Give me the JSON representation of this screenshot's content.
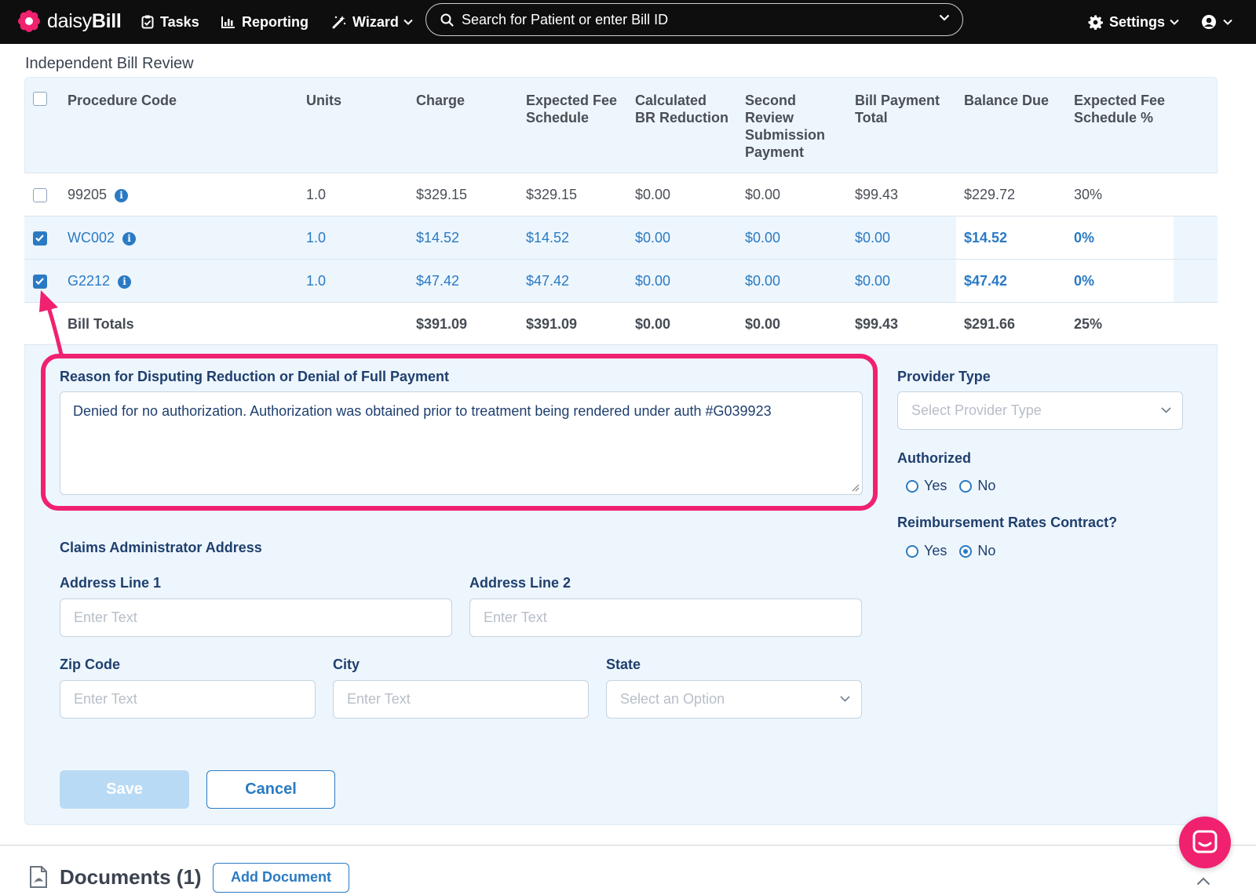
{
  "nav": {
    "logo_prefix": "daisy",
    "logo_suffix": "Bill",
    "tasks": "Tasks",
    "reporting": "Reporting",
    "wizard": "Wizard",
    "search_placeholder": "Search for Patient or enter Bill ID",
    "settings": "Settings"
  },
  "section_title": "Independent Bill Review",
  "table": {
    "headers": [
      [
        "Procedure Code"
      ],
      [
        "Units"
      ],
      [
        "Charge"
      ],
      [
        "Expected Fee",
        "Schedule"
      ],
      [
        "Calculated",
        "BR Reduction"
      ],
      [
        "Second",
        "Review",
        "Submission",
        "Payment"
      ],
      [
        "Bill Payment",
        "Total"
      ],
      [
        "Balance Due"
      ],
      [
        "Expected Fee",
        "Schedule %"
      ]
    ],
    "rows": [
      {
        "selected": false,
        "code": "99205",
        "units": "1.0",
        "charge": "$329.15",
        "expected_fee": "$329.15",
        "br_reduction": "$0.00",
        "second_review": "$0.00",
        "bill_payment": "$99.43",
        "balance_due": "$229.72",
        "fee_pct": "30%"
      },
      {
        "selected": true,
        "code": "WC002",
        "units": "1.0",
        "charge": "$14.52",
        "expected_fee": "$14.52",
        "br_reduction": "$0.00",
        "second_review": "$0.00",
        "bill_payment": "$0.00",
        "balance_due": "$14.52",
        "fee_pct": "0%"
      },
      {
        "selected": true,
        "code": "G2212",
        "units": "1.0",
        "charge": "$47.42",
        "expected_fee": "$47.42",
        "br_reduction": "$0.00",
        "second_review": "$0.00",
        "bill_payment": "$0.00",
        "balance_due": "$47.42",
        "fee_pct": "0%"
      }
    ],
    "totals": {
      "label": "Bill Totals",
      "charge": "$391.09",
      "expected_fee": "$391.09",
      "br_reduction": "$0.00",
      "second_review": "$0.00",
      "bill_payment": "$99.43",
      "balance_due": "$291.66",
      "fee_pct": "25%"
    }
  },
  "form": {
    "reason_label": "Reason for Disputing Reduction or Denial of Full Payment",
    "reason_value": "Denied for no authorization. Authorization was obtained prior to treatment being rendered under auth #G039923",
    "provider_type_label": "Provider Type",
    "provider_type_placeholder": "Select Provider Type",
    "authorized_label": "Authorized",
    "authorized_selected": null,
    "reimbursement_label": "Reimbursement Rates Contract?",
    "reimbursement_selected": "No",
    "yes": "Yes",
    "no": "No",
    "claims_address_label": "Claims Administrator Address",
    "address1_label": "Address Line 1",
    "address2_label": "Address Line 2",
    "zip_label": "Zip Code",
    "city_label": "City",
    "state_label": "State",
    "text_placeholder": "Enter Text",
    "state_placeholder": "Select an Option",
    "save": "Save",
    "cancel": "Cancel"
  },
  "documents": {
    "title": "Documents (1)",
    "add": "Add Document"
  },
  "colors": {
    "accent": "#2a7ac3",
    "highlight": "#f0216f",
    "nav_bg": "#0e0e0e",
    "panel_bg": "#eef6fd"
  }
}
